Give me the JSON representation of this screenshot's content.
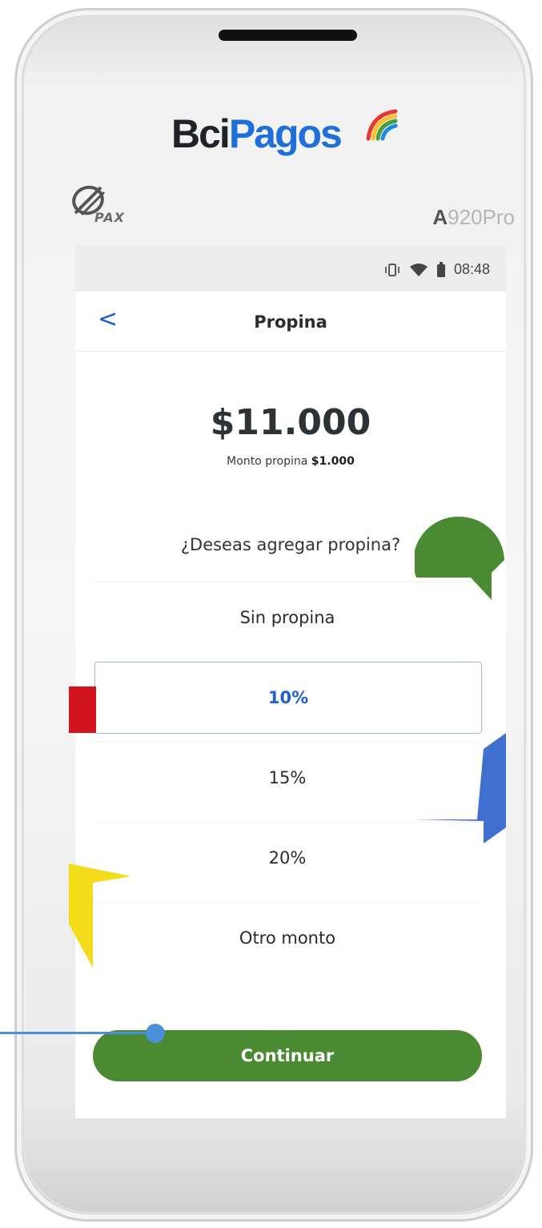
{
  "device": {
    "brand_part1": "Bci",
    "brand_part2": "Pagos",
    "maker_logo_text": "PAX",
    "model_first": "A",
    "model_rest": "920Pro"
  },
  "statusbar": {
    "time": "08:48",
    "icons": [
      "vibrate-icon",
      "wifi-icon",
      "battery-icon"
    ]
  },
  "appbar": {
    "back_label": "<",
    "title": "Propina"
  },
  "summary": {
    "total": "$11.000",
    "tip_label": "Monto propina",
    "tip_value": "$1.000"
  },
  "question": "¿Deseas agregar propina?",
  "options": [
    {
      "label": "Sin propina",
      "selected": false
    },
    {
      "label": "10%",
      "selected": true
    },
    {
      "label": "15%",
      "selected": false
    },
    {
      "label": "20%",
      "selected": false
    },
    {
      "label": "Otro monto",
      "selected": false
    }
  ],
  "continue_label": "Continuar",
  "colors": {
    "brand_blue": "#1f6fd9",
    "accent_green": "#4a8a32",
    "selected_text": "#1f5fcf",
    "deco_red": "#d2141f",
    "deco_blue": "#3f6fcf",
    "deco_yellow": "#f5dc1a",
    "pointer": "#4b8fd4"
  }
}
